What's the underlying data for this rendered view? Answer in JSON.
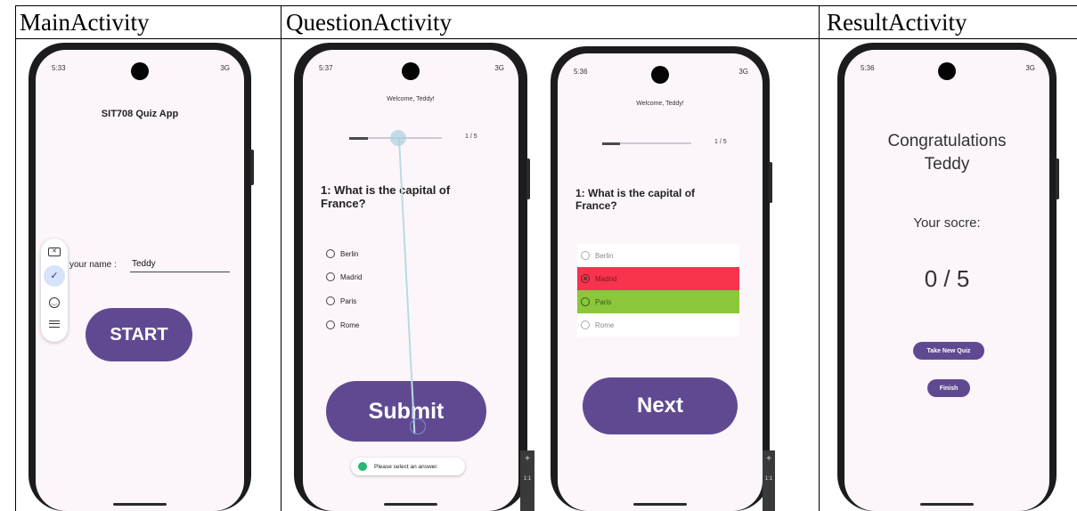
{
  "columns": {
    "main": "MainActivity",
    "question": "QuestionActivity",
    "result": "ResultActivity"
  },
  "main_screen": {
    "status_time": "5:33",
    "status_right": "3G",
    "title": "SIT708 Quiz App",
    "name_label": "your name :",
    "name_value": "Teddy",
    "start_label": "START"
  },
  "question_screen_a": {
    "status_time": "5:37",
    "status_right": "3G",
    "welcome": "Welcome, Teddy!",
    "progress_text": "1 / 5",
    "progress_fraction": 0.2,
    "question": "1: What is the capital of France?",
    "options": [
      "Berlin",
      "Madrid",
      "Paris",
      "Rome"
    ],
    "submit_label": "Submit",
    "toast": "Please select an answer."
  },
  "question_screen_b": {
    "status_time": "5:36",
    "status_right": "3G",
    "welcome": "Welcome, Teddy!",
    "progress_text": "1 / 5",
    "progress_fraction": 0.2,
    "question": "1: What is the capital of France?",
    "options": [
      "Berlin",
      "Madrid",
      "Paris",
      "Rome"
    ],
    "selected": "Madrid",
    "wrong_color": "#f7334d",
    "correct_color": "#8bc63b",
    "next_label": "Next"
  },
  "result_screen": {
    "status_time": "5:36",
    "status_right": "3G",
    "congrats": "Congratulations",
    "name": "Teddy",
    "score_label": "Your socre:",
    "score": "0 / 5",
    "new_quiz_label": "Take New Quiz",
    "finish_label": "Finish"
  },
  "colors": {
    "primary": "#5f4a92",
    "screen_bg": "#fcf6fb"
  }
}
